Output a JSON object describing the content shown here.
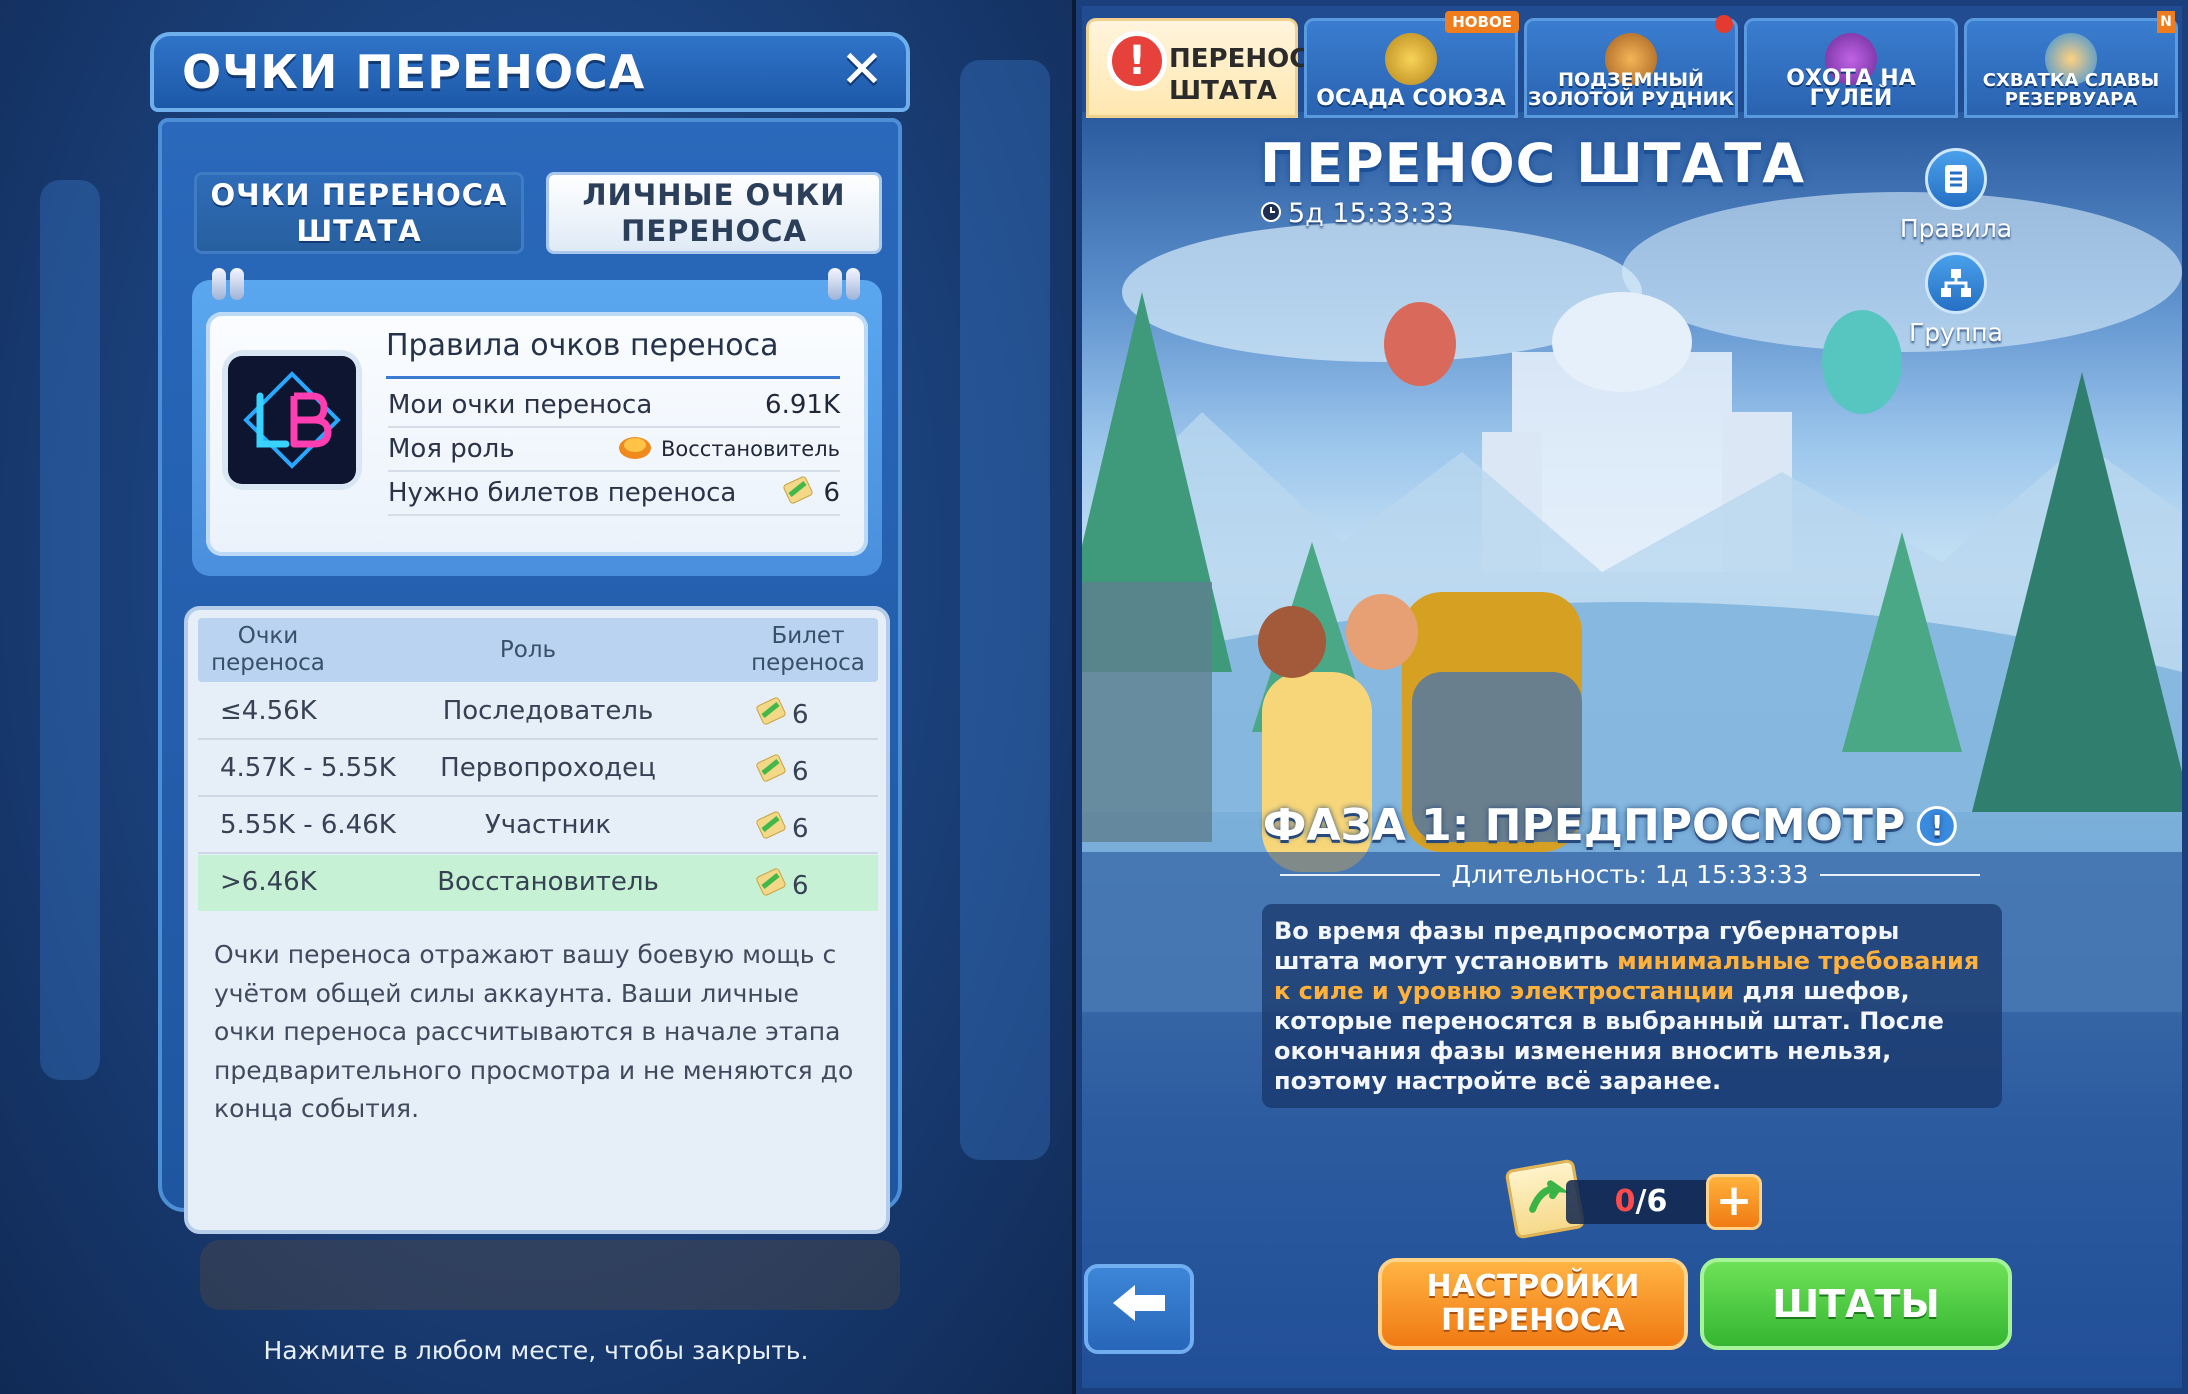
{
  "left": {
    "dialog_title": "ОЧКИ ПЕРЕНОСА",
    "tabs": [
      "ОЧКИ ПЕРЕНОСА ШТАТА",
      "ЛИЧНЫЕ ОЧКИ ПЕРЕНОСА"
    ],
    "rules": {
      "title": "Правила очков переноса",
      "rows": [
        {
          "label": "Мои очки переноса",
          "value": "6.91K"
        },
        {
          "label": "Моя роль",
          "value": "Восстановитель"
        },
        {
          "label": "Нужно билетов переноса",
          "value": "6"
        }
      ]
    },
    "table": {
      "headers": [
        "Очки переноса",
        "Роль",
        "Билет переноса"
      ],
      "rows": [
        {
          "points": "≤4.56K",
          "role": "Последователь",
          "tickets": "6"
        },
        {
          "points": "4.57K - 5.55K",
          "role": "Первопроходец",
          "tickets": "6"
        },
        {
          "points": "5.55K - 6.46K",
          "role": "Участник",
          "tickets": "6"
        },
        {
          "points": ">6.46K",
          "role": "Восстановитель",
          "tickets": "6"
        }
      ]
    },
    "note": "Очки переноса отражают вашу боевую мощь с учётом общей силы аккаунта. Ваши личные очки переноса рассчитываются в начале этапа предварительного просмотра и не меняются до конца события.",
    "close_hint": "Нажмите в любом месте, чтобы закрыть."
  },
  "right": {
    "tabs": [
      {
        "label": "ПЕРЕНОС ШТАТА",
        "icon": "alert-icon"
      },
      {
        "label": "ОСАДА СОЮЗА",
        "icon": "helmet-icon",
        "badge": "НОВОЕ"
      },
      {
        "label": "ПОДЗЕМНЫЙ ЗОЛОТОЙ РУДНИК",
        "icon": "gold-mine-icon"
      },
      {
        "label": "ОХОТА НА ГУЛЕЙ",
        "icon": "ghoul-icon"
      },
      {
        "label": "СХВАТКА СЛАВЫ РЕЗЕРВУАРА",
        "icon": "reservoir-icon",
        "badge": "N"
      }
    ],
    "title": "ПЕРЕНОС ШТАТА",
    "timer": "5д 15:33:33",
    "rules_label": "Правила",
    "group_label": "Группа",
    "phase_title": "ФАЗА 1: ПРЕДПРОСМОТР",
    "duration": "Длительность: 1д 15:33:33",
    "desc_1": "Во время фазы предпросмотра губернаторы штата могут установить ",
    "desc_highlight": "минимальные требования к силе и уровню электростанции",
    "desc_2": " для шефов, которые переносятся в выбранный штат. После окончания фазы изменения вносить нельзя, поэтому настройте всё заранее.",
    "tickets_current": "0",
    "tickets_total": "/6",
    "settings_button": "НАСТРОЙКИ ПЕРЕНОСА",
    "states_button": "ШТАТЫ"
  },
  "colors": {
    "accent_orange": "#ffb13b",
    "button_green": "#35b531",
    "button_orange": "#f07913",
    "highlight_row": "#c7f1d5"
  }
}
